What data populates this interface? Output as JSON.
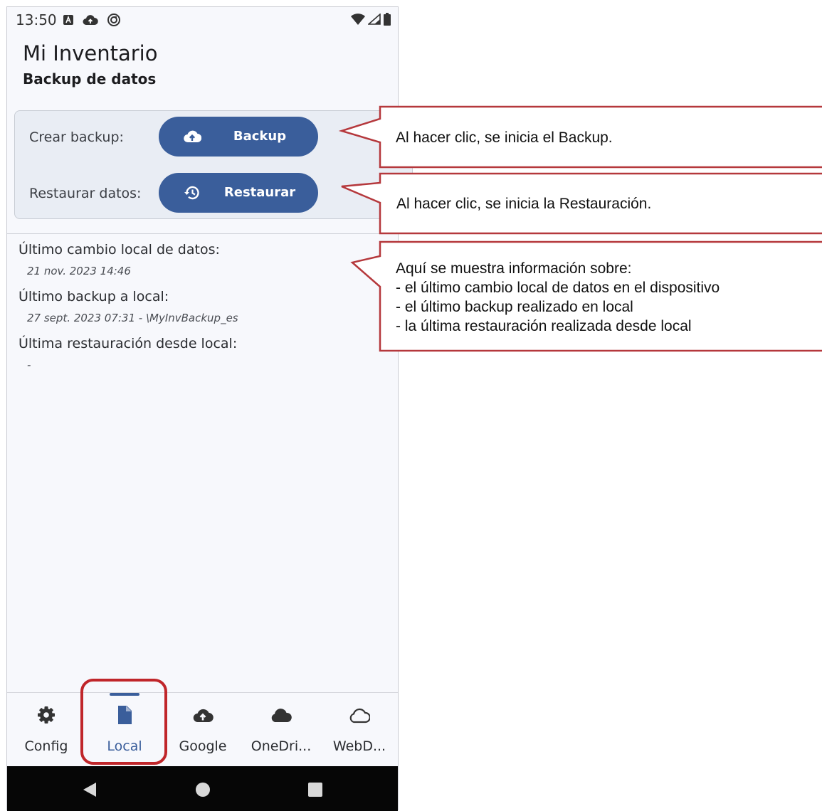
{
  "status_bar": {
    "time": "13:50",
    "left_icons": [
      "notification-a-icon",
      "cloud-upload-icon",
      "sync-icon"
    ],
    "right_icons": [
      "wifi-icon",
      "signal-icon",
      "battery-icon"
    ]
  },
  "app": {
    "title": "Mi Inventario",
    "subtitle": "Backup de datos"
  },
  "actions": {
    "backup_label": "Crear backup:",
    "backup_button": "Backup",
    "backup_icon": "cloud-upload-icon",
    "restore_label": "Restaurar datos:",
    "restore_button": "Restaurar",
    "restore_icon": "restore-history-icon",
    "button_color": "#3a5e9b"
  },
  "info": {
    "last_local_change_label": "Último cambio local de datos:",
    "last_local_change_value": "21 nov. 2023 14:46",
    "last_backup_label": "Último backup a local:",
    "last_backup_value": "27 sept. 2023 07:31 - \\MyInvBackup_es",
    "last_restore_label": "Última restauración desde local:",
    "last_restore_value": "-"
  },
  "bottom_nav": {
    "items": [
      {
        "label": "Config",
        "icon": "gear-icon",
        "active": false
      },
      {
        "label": "Local",
        "icon": "file-icon",
        "active": true
      },
      {
        "label": "Google",
        "icon": "cloud-upload-icon",
        "active": false
      },
      {
        "label": "OneDri...",
        "icon": "cloud-filled-icon",
        "active": false
      },
      {
        "label": "WebD...",
        "icon": "cloud-outline-icon",
        "active": false
      }
    ]
  },
  "system_nav": [
    "back-icon",
    "home-icon",
    "recents-icon"
  ],
  "callouts": {
    "backup": "Al hacer clic, se inicia el Backup.",
    "restore": "Al hacer clic, se inicia la Restauración.",
    "info_lines": [
      "Aquí se muestra información sobre:",
      "- el último cambio local de datos en el dispositivo",
      "- el último backup realizado en local",
      "- la última restauración realizada desde local"
    ],
    "border_color": "#b5383c"
  }
}
